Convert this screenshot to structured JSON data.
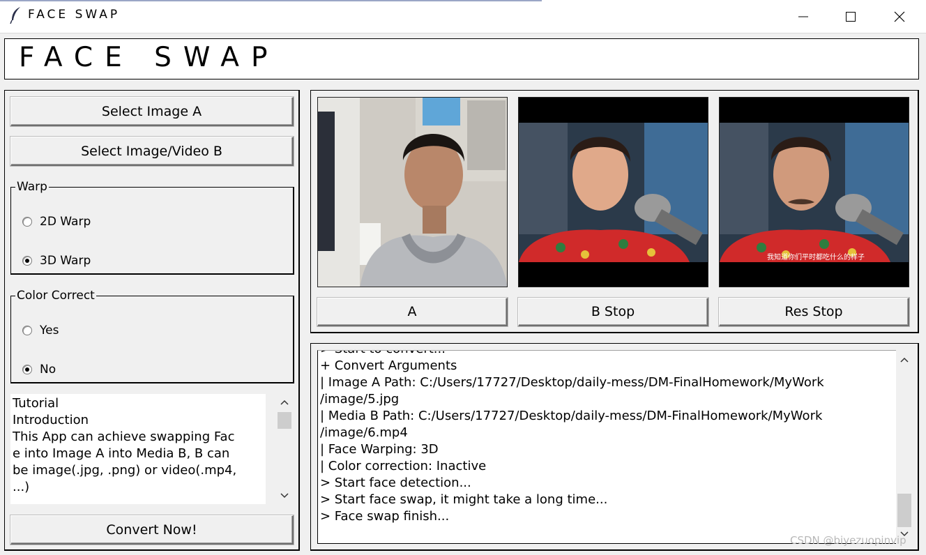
{
  "window": {
    "title": "FACE SWAP"
  },
  "header": {
    "title": "FACE SWAP"
  },
  "controls": {
    "select_a_label": "Select Image A",
    "select_b_label": "Select Image/Video B",
    "convert_label": "Convert Now!"
  },
  "warp": {
    "legend": "Warp",
    "options": [
      {
        "label": "2D Warp",
        "checked": false
      },
      {
        "label": "3D Warp",
        "checked": true
      }
    ]
  },
  "color_correct": {
    "legend": "Color Correct",
    "options": [
      {
        "label": "Yes",
        "checked": false
      },
      {
        "label": "No",
        "checked": true
      }
    ]
  },
  "tutorial": {
    "lines": [
      "Tutorial",
      "",
      "Introduction",
      "This App can achieve swapping Fac",
      "e into Image A into Media B, B can",
      "be image(.jpg, .png) or video(.mp4,",
      "...)"
    ]
  },
  "preview": {
    "buttons": {
      "a": "A",
      "b": "B Stop",
      "res": "Res Stop"
    },
    "subtitle": "我知道你们平时都吃什么的样子"
  },
  "log": {
    "lines": [
      "> Start to convert...",
      "+ Convert Arguments",
      "| Image A Path: C:/Users/17727/Desktop/daily-mess/DM-FinalHomework/MyWork",
      "/image/5.jpg",
      "| Media B Path: C:/Users/17727/Desktop/daily-mess/DM-FinalHomework/MyWork",
      "/image/6.mp4",
      "| Face Warping: 3D",
      "| Color correction: Inactive",
      "> Start face detection...",
      "> Start face swap, it might take a long time...",
      "> Face swap finish..."
    ]
  },
  "watermark": "CSDN @biyezuopinvip",
  "colors": {
    "window_bg": "#f0f0f0",
    "border": "#000000",
    "thumb": "#cdcdcd"
  }
}
